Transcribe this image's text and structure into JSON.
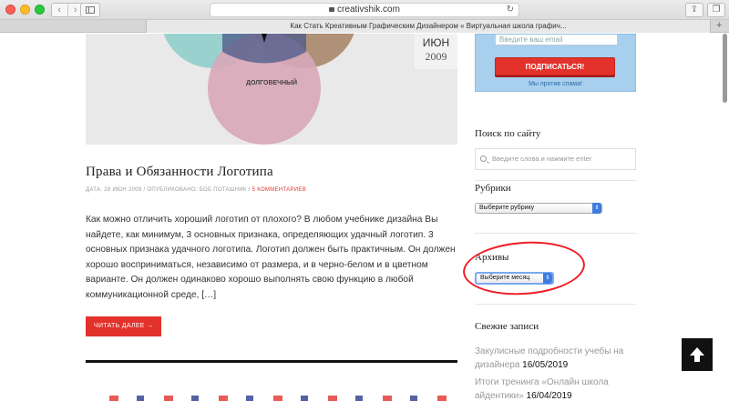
{
  "browser": {
    "url": "creativshik.com",
    "tab_title": "Как Стать Креативным Графическим Дизайнером « Виртуальная школа графич...",
    "back_glyph": "‹",
    "forward_glyph": "›",
    "reload_glyph": "↻",
    "share_glyph": "⇪",
    "tabs_glyph": "❐",
    "new_tab_glyph": "+"
  },
  "post": {
    "hero_label": "ДОЛГОВЕЧНЫЙ",
    "date_month": "ИЮН",
    "date_year": "2009",
    "title": "Права и Обязанности Логотипа",
    "meta_prefix": "ДАТА: 28 ИЮН 2009 /  ОПУБЛИКОВАНО: БОБ ПОТАШНИК /",
    "meta_comments": "5 КОММЕНТАРИЕВ",
    "excerpt": "Как можно отличить хороший логотип от плохого? В любом учебнике дизайна Вы найдете, как минимум, 3 основных признака, определяющих удачный логотип. 3 основных признака удачного логотипа. Логотип должен быть практичным. Он должен хорошо восприниматься, независимо от размера, и в черно-белом и в цветном варианте. Он должен одинаково хорошо выполнять свою функцию в любой коммуникационной среде, […]",
    "read_more": "ЧИТАТЬ ДАЛЕЕ →"
  },
  "subscribe": {
    "email_placeholder": "Введите ваш email",
    "button": "ПОДПИСАТЬСЯ!",
    "antispam": "Мы против спама!"
  },
  "search": {
    "title": "Поиск по сайту",
    "placeholder": "Введите слова и нажмите enter"
  },
  "categories": {
    "title": "Рубрики",
    "selected": "Выберите рубрику"
  },
  "archives": {
    "title": "Архивы",
    "selected": "Выберите месяц"
  },
  "recent": {
    "title": "Свежие записи",
    "items": [
      {
        "text": "Закулисные подробности учебы на дизайнера",
        "date": "16/05/2019"
      },
      {
        "text": "Итоги тренинга «Онлайн школа айдентики»",
        "date": "16/04/2019"
      }
    ]
  },
  "colors": {
    "accent": "#e2322b",
    "subscribe_bg": "#a8d0ee",
    "annotation": "#ee1c24"
  }
}
